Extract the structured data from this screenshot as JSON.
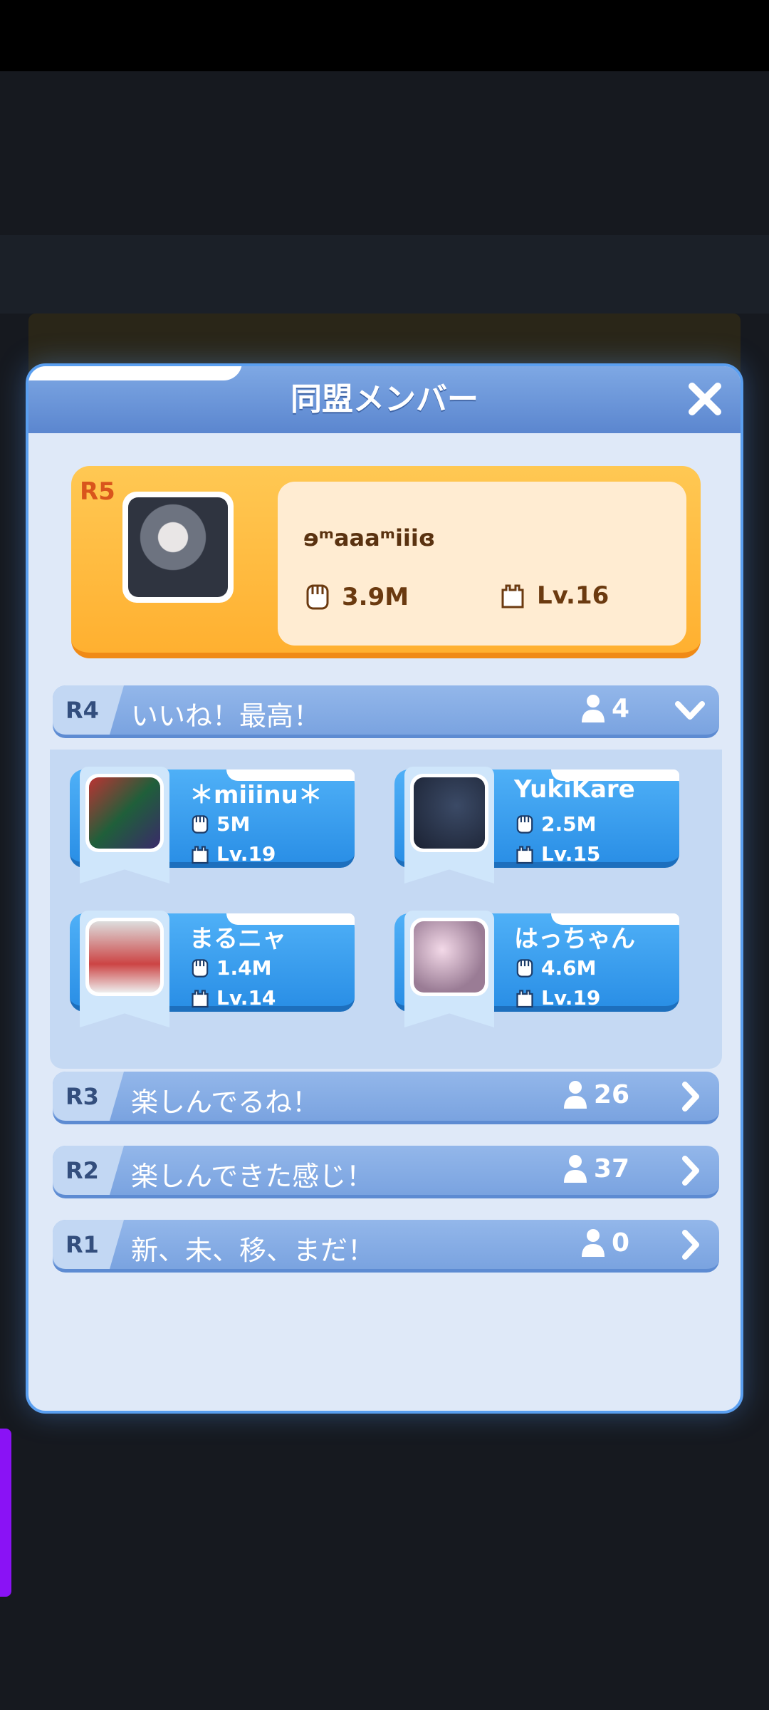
{
  "dialog": {
    "title": "同盟メンバー",
    "close_icon": "close-icon"
  },
  "leader": {
    "rank": "R5",
    "name": "ɘᵐaaaᵐiiiɞ",
    "power": "3.9M",
    "level": "Lv.16"
  },
  "ranks": [
    {
      "rank": "R4",
      "title": "いいね！最高！",
      "count": "4",
      "expanded": true,
      "members": [
        {
          "name": "＊miiinu＊",
          "power": "5M",
          "level": "Lv.19"
        },
        {
          "name": "YukiKare",
          "power": "2.5M",
          "level": "Lv.15"
        },
        {
          "name": "まるニャ",
          "power": "1.4M",
          "level": "Lv.14"
        },
        {
          "name": "はっちゃん",
          "power": "4.6M",
          "level": "Lv.19"
        }
      ]
    },
    {
      "rank": "R3",
      "title": "楽しんでるね！",
      "count": "26",
      "expanded": false
    },
    {
      "rank": "R2",
      "title": "楽しんできた感じ！",
      "count": "37",
      "expanded": false
    },
    {
      "rank": "R1",
      "title": "新、未、移、まだ！",
      "count": "0",
      "expanded": false
    }
  ],
  "colors": {
    "accent": "#5a9ff0",
    "leader_card": "#ffb030",
    "member_card": "#2a8fe6",
    "rank_bar": "#7aa3e0"
  }
}
